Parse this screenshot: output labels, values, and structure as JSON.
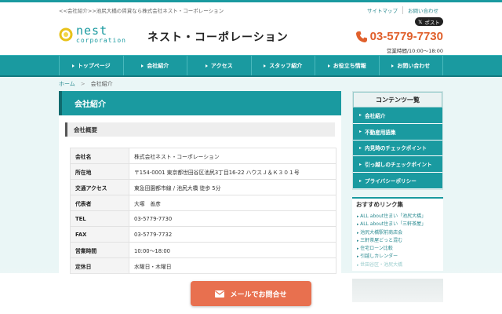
{
  "header": {
    "tagline": "<<会社紹介>>池尻大橋の賃貸なら株式会社ネスト・コーポレーション",
    "top_links": [
      "サイトマップ",
      "お問い合わせ"
    ],
    "post_label": "ポスト",
    "logo_word": "nest",
    "logo_sub": "corporation",
    "company_name": "ネスト・コーポレーション",
    "phone": "03-5779-7730",
    "hours": "営業時間/10:00～18:00"
  },
  "nav": {
    "items": [
      "トップページ",
      "会社紹介",
      "アクセス",
      "スタッフ紹介",
      "お役立ち情報",
      "お問い合わせ"
    ]
  },
  "breadcrumb": {
    "home": "ホーム",
    "separator": ">",
    "current": "会社紹介"
  },
  "main": {
    "title": "会社紹介",
    "section_title": "会社概要",
    "rows": [
      {
        "key": "会社名",
        "value": "株式会社ネスト・コーポレーション"
      },
      {
        "key": "所在地",
        "value": "〒154-0001 東京都世田谷区池尻3丁目16-22 ハウスＪ＆Ｋ３０１号"
      },
      {
        "key": "交通アクセス",
        "value": "東急田園都市線 / 池尻大橋 徒歩 5分"
      },
      {
        "key": "代表者",
        "value": "大塚　善彦"
      },
      {
        "key": "TEL",
        "value": "03-5779-7730"
      },
      {
        "key": "FAX",
        "value": "03-5779-7732"
      },
      {
        "key": "営業時間",
        "value": "10:00～18:00"
      },
      {
        "key": "定休日",
        "value": "水曜日・木曜日"
      }
    ]
  },
  "sidebar": {
    "contents_title": "コンテンツ一覧",
    "contents": [
      "会社紹介",
      "不動産用語集",
      "内見時のチェックポイント",
      "引っ越しのチェックポイント",
      "プライバシーポリシー"
    ],
    "recommend_title": "おすすめリンク集",
    "recommend": [
      "ALL about住まい「池尻大橋」",
      "ALL about住まい「三軒茶屋」",
      "池尻大橋駅前商店会",
      "三軒茶屋どっと混む",
      "住宅ローン比較",
      "引越しカレンダー",
      "世田谷区・池尻大橋"
    ]
  },
  "cta": {
    "mail_label": "メールでお問合せ"
  },
  "colors": {
    "brand": "#1a9aa0",
    "phone": "#e0602c",
    "cta": "#e8704f"
  }
}
